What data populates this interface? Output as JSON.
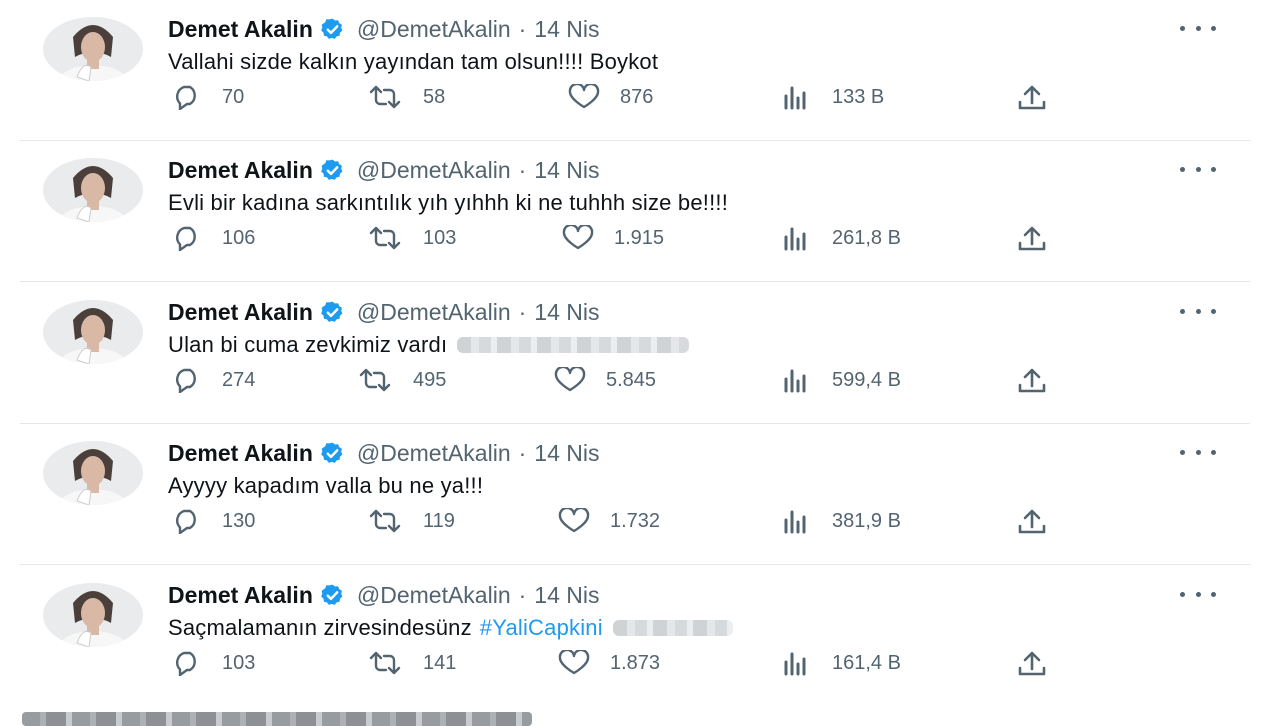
{
  "tweets": [
    {
      "name": "Demet Akalin",
      "handle": "@DemetAkalin",
      "dot": "·",
      "time": "14 Nis",
      "text": "Vallahi sizde kalkın yayından tam olsun!!!! Boykot",
      "hashtag": "",
      "replies": "70",
      "retweets": "58",
      "likes": "876",
      "views": "133 B"
    },
    {
      "name": "Demet Akalin",
      "handle": "@DemetAkalin",
      "dot": "·",
      "time": "14 Nis",
      "text": "Evli bir kadına sarkıntılık yıh yıhhh ki ne tuhhh size be!!!!",
      "hashtag": "",
      "replies": "106",
      "retweets": "103",
      "likes": "1.915",
      "views": "261,8 B"
    },
    {
      "name": "Demet Akalin",
      "handle": "@DemetAkalin",
      "dot": "·",
      "time": "14 Nis",
      "text": "Ulan bi cuma zevkimiz vardı",
      "hashtag": "",
      "replies": "274",
      "retweets": "495",
      "likes": "5.845",
      "views": "599,4 B"
    },
    {
      "name": "Demet Akalin",
      "handle": "@DemetAkalin",
      "dot": "·",
      "time": "14 Nis",
      "text": "Ayyyy kapadım valla bu ne ya!!!",
      "hashtag": "",
      "replies": "130",
      "retweets": "119",
      "likes": "1.732",
      "views": "381,9 B"
    },
    {
      "name": "Demet Akalin",
      "handle": "@DemetAkalin",
      "dot": "·",
      "time": "14 Nis",
      "text": "Saçmalamanın zirvesindesünz",
      "hashtag": "#YaliCapkini",
      "replies": "103",
      "retweets": "141",
      "likes": "1.873",
      "views": "161,4 B"
    }
  ],
  "icons": {
    "reply": "reply-icon",
    "retweet": "retweet-icon",
    "like": "heart-icon",
    "views": "views-icon",
    "share": "share-icon",
    "more": "more-icon",
    "verified": "verified-badge-icon"
  },
  "colors": {
    "verified": "#1d9bf0",
    "hashtag": "#1d9bf0",
    "secondary": "#536471",
    "text": "#0f1419"
  }
}
